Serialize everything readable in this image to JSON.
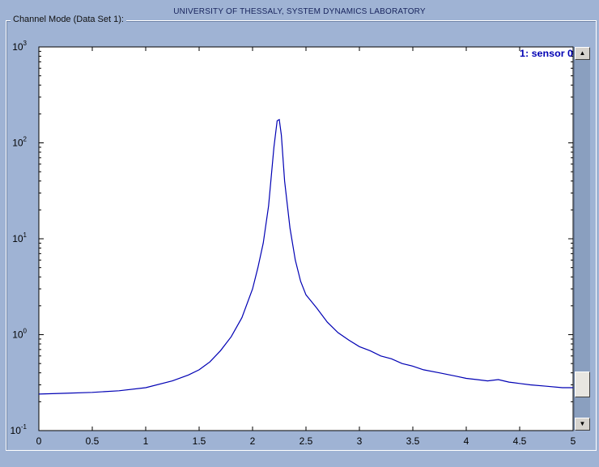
{
  "window": {
    "lab_title": "UNIVERSITY OF THESSALY, SYSTEM DYNAMICS LABORATORY",
    "frame_title": "Channel Mode (Data Set 1):"
  },
  "scrollbar": {
    "up_arrow": "▲",
    "down_arrow": "▼",
    "position_fraction": 0.94
  },
  "colors": {
    "background": "#9fb3d4",
    "plot_area": "#ffffff",
    "trace": "#0000b4",
    "sensor_label": "#0000b4"
  },
  "chart_data": {
    "type": "line",
    "title": "",
    "xlabel": "",
    "ylabel": "",
    "xlim": [
      0,
      5
    ],
    "ylim": [
      0.1,
      1000
    ],
    "yscale": "log",
    "grid": false,
    "x_ticks": [
      "0",
      "0.5",
      "1",
      "1.5",
      "2",
      "2.5",
      "3",
      "3.5",
      "4",
      "4.5",
      "5"
    ],
    "y_ticks": [
      {
        "base": "10",
        "exp": "-1"
      },
      {
        "base": "10",
        "exp": "0"
      },
      {
        "base": "10",
        "exp": "1"
      },
      {
        "base": "10",
        "exp": "2"
      },
      {
        "base": "10",
        "exp": "3"
      }
    ],
    "legend_label": "1: sensor 0",
    "series": [
      {
        "name": "1: sensor 0",
        "x": [
          0,
          0.25,
          0.5,
          0.75,
          1.0,
          1.25,
          1.4,
          1.5,
          1.6,
          1.7,
          1.8,
          1.9,
          2.0,
          2.05,
          2.1,
          2.15,
          2.2,
          2.23,
          2.25,
          2.27,
          2.3,
          2.35,
          2.4,
          2.45,
          2.5,
          2.6,
          2.7,
          2.8,
          2.9,
          3.0,
          3.1,
          3.2,
          3.3,
          3.4,
          3.5,
          3.6,
          3.75,
          3.9,
          4.0,
          4.1,
          4.2,
          4.3,
          4.4,
          4.5,
          4.6,
          4.75,
          4.9,
          5.0
        ],
        "y": [
          0.24,
          0.245,
          0.25,
          0.26,
          0.28,
          0.33,
          0.38,
          0.43,
          0.52,
          0.68,
          0.95,
          1.5,
          3.0,
          5.0,
          9.0,
          22,
          90,
          170,
          175,
          120,
          40,
          13,
          6.0,
          3.6,
          2.6,
          1.9,
          1.35,
          1.05,
          0.88,
          0.75,
          0.68,
          0.6,
          0.56,
          0.5,
          0.47,
          0.43,
          0.4,
          0.37,
          0.35,
          0.34,
          0.33,
          0.34,
          0.32,
          0.31,
          0.3,
          0.29,
          0.28,
          0.28
        ]
      }
    ]
  }
}
